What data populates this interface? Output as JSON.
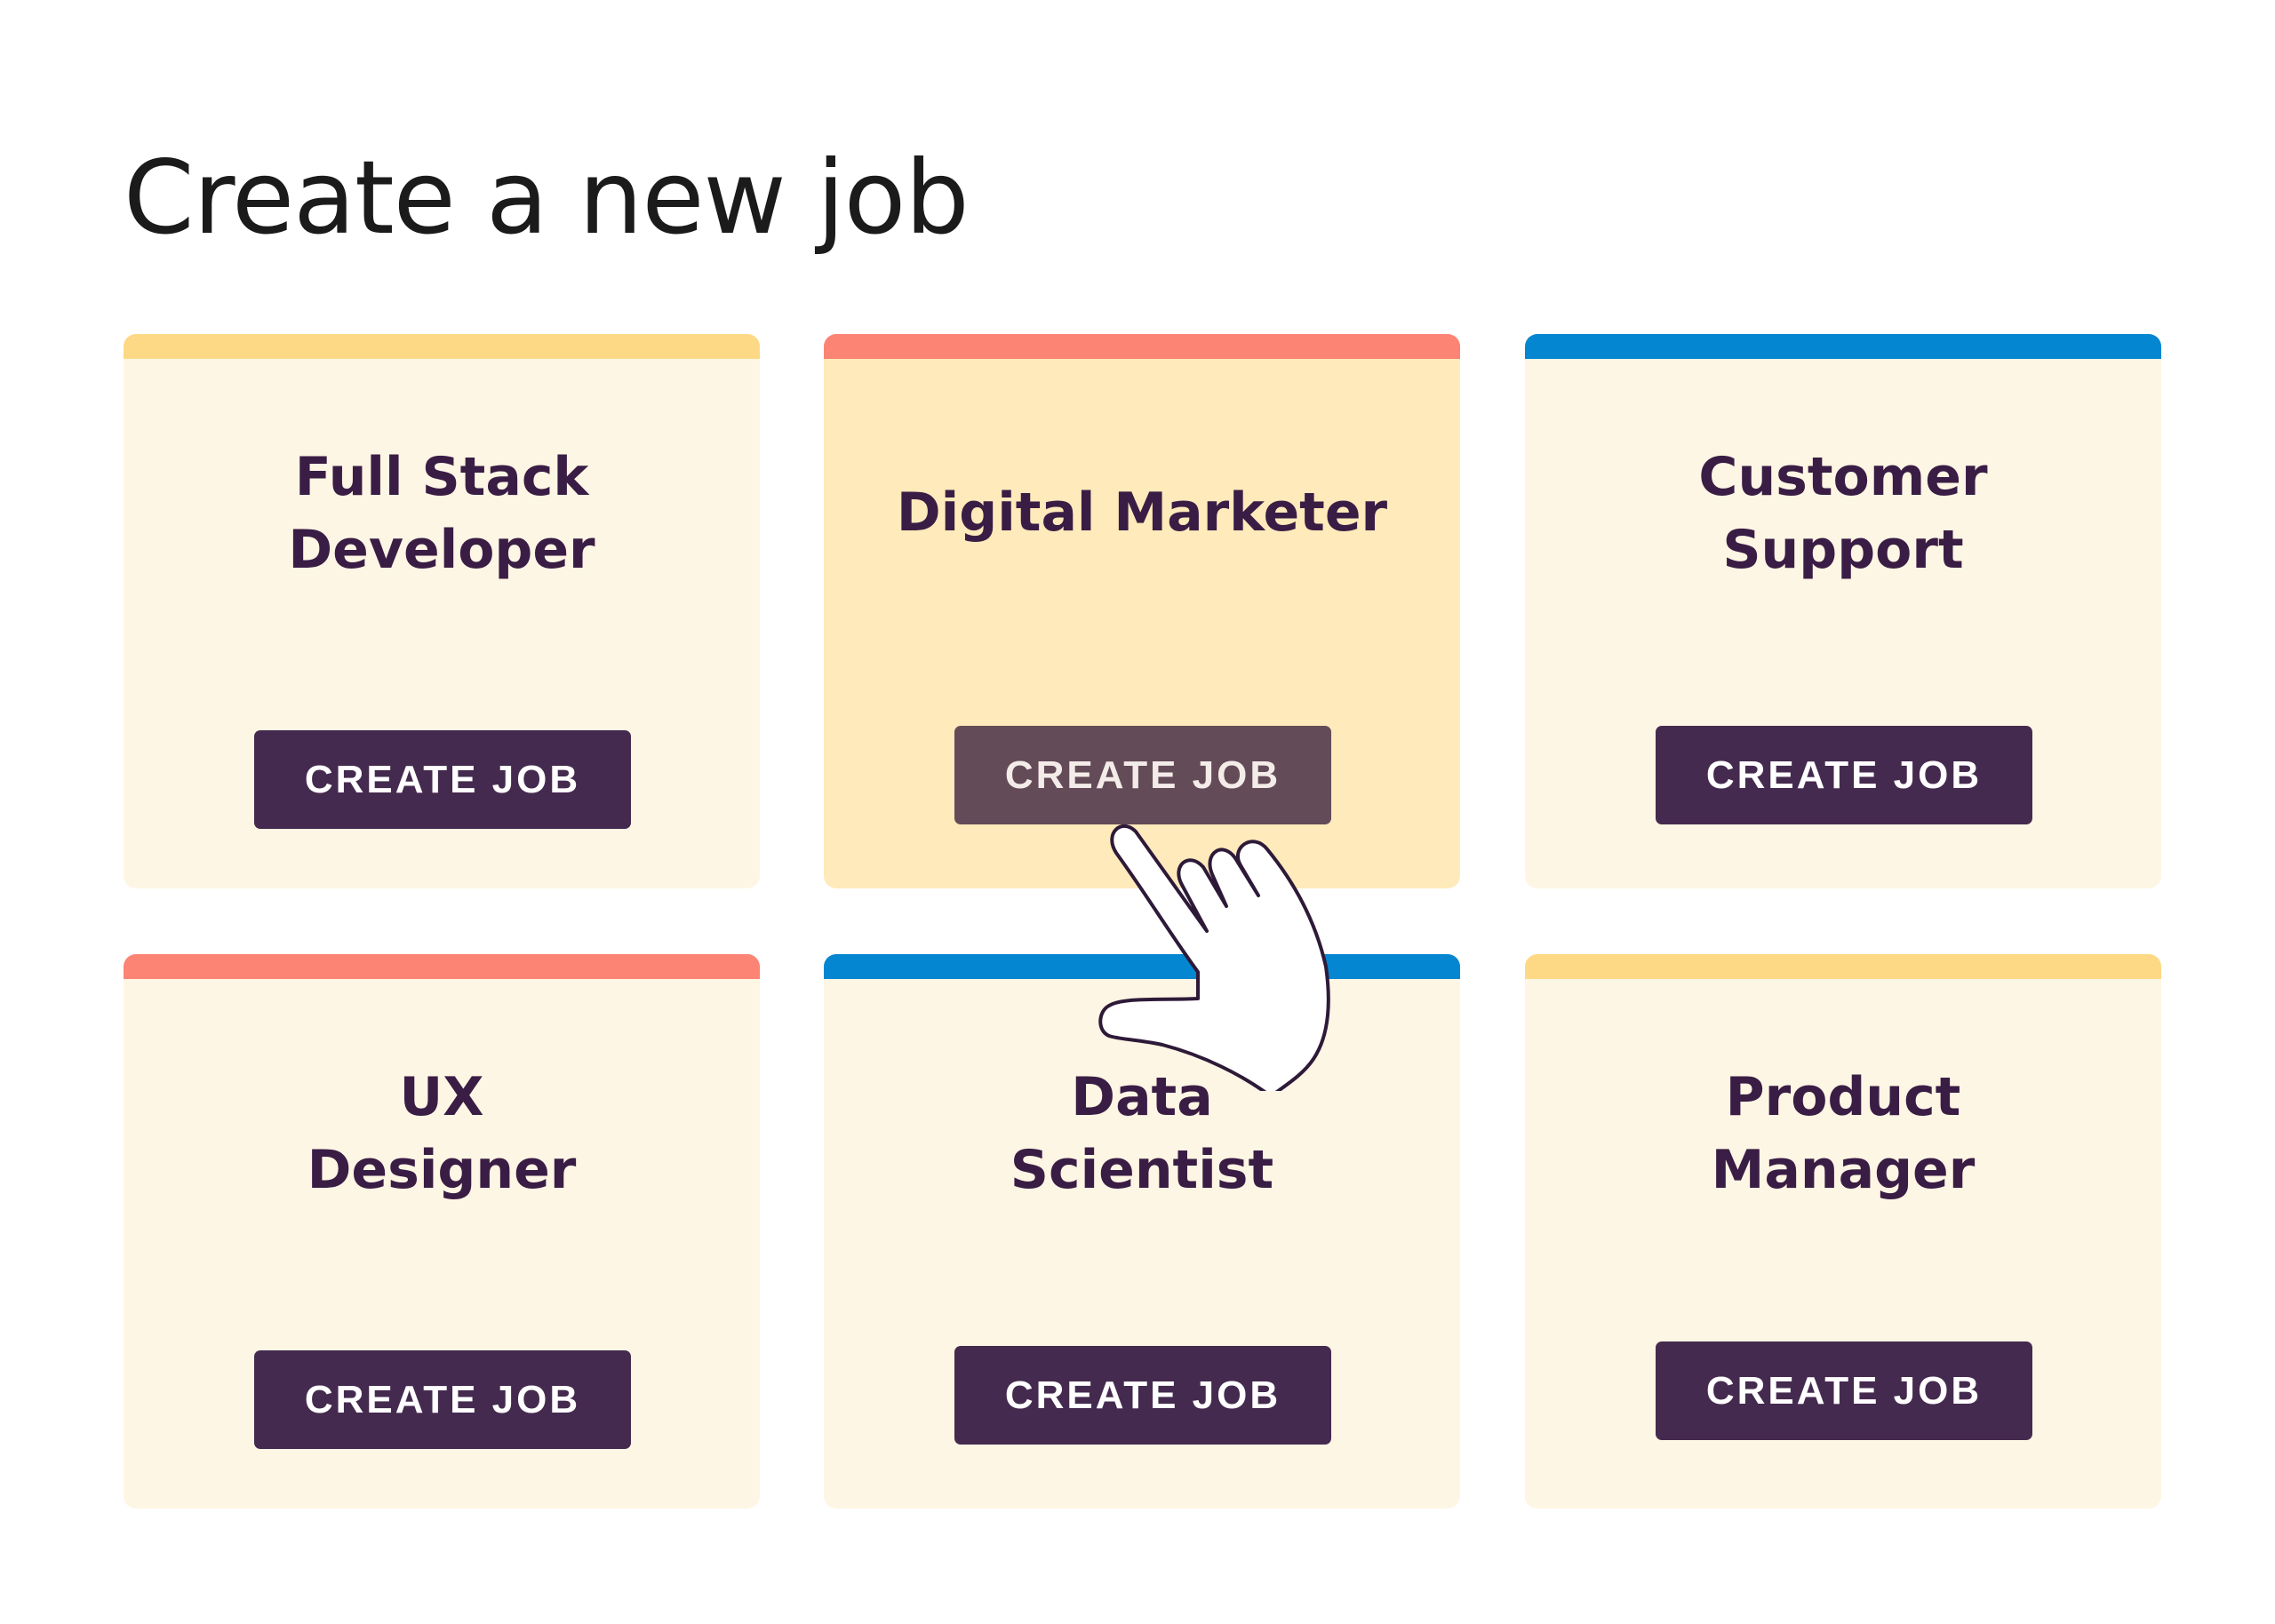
{
  "page": {
    "title": "Create a new job"
  },
  "colors": {
    "accent_yellow": "#fdd985",
    "accent_coral": "#fc8474",
    "accent_blue": "#0586d1",
    "card_bg": "#fef6e4",
    "card_bg_active": "#ffeabb",
    "button_bg": "#452a4f",
    "button_bg_hover": "#644b58",
    "title_text": "#3a1d45"
  },
  "cards": [
    {
      "title_lines": [
        "Full Stack",
        "Developer"
      ],
      "accent": "yellow",
      "button_label": "CREATE JOB",
      "state": "default"
    },
    {
      "title_lines": [
        "Digital Marketer"
      ],
      "accent": "coral",
      "button_label": "CREATE JOB",
      "state": "hover"
    },
    {
      "title_lines": [
        "Customer",
        "Support"
      ],
      "accent": "blue",
      "button_label": "CREATE JOB",
      "state": "default"
    },
    {
      "title_lines": [
        "UX",
        "Designer"
      ],
      "accent": "coral",
      "button_label": "CREATE JOB",
      "state": "default"
    },
    {
      "title_lines": [
        "Data",
        "Scientist"
      ],
      "accent": "blue",
      "button_label": "CREATE JOB",
      "state": "default"
    },
    {
      "title_lines": [
        "Product",
        "Manager"
      ],
      "accent": "yellow",
      "button_label": "CREATE JOB",
      "state": "default"
    }
  ],
  "cursor": {
    "icon": "hand-pointer-icon"
  }
}
